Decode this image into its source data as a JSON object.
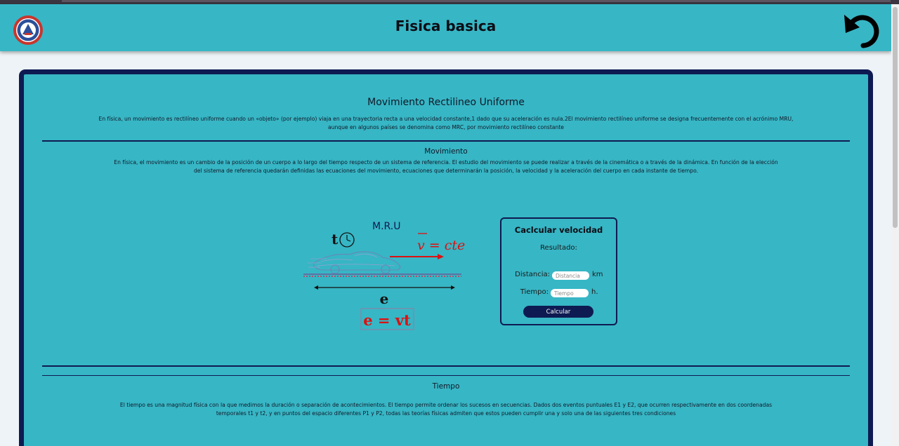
{
  "header": {
    "title": "Fisica basica",
    "logo_icon": "university-seal-logo",
    "back_icon": "undo-arrow-icon",
    "background": "#37b6c5"
  },
  "colors": {
    "card_border": "#0e1a52",
    "card_bg": "#37b6c5",
    "arrow_red": "#dd1111",
    "button": "#0e1a52"
  },
  "intro": {
    "title": "Movimiento Rectilineo Uniforme",
    "text_line1": "En física, un movimiento es rectilíneo uniforme cuando un «objeto» (por ejemplo) viaja en una trayectoria recta a una velocidad constante,1 dado que su aceleración es nula.2El movimiento rectilíneo uniforme se designa frecuentemente con el acrónimo MRU,",
    "text_line2": "aunque en algunos países se denomina como MRC, por movimiento rectilíneo constante"
  },
  "movimiento": {
    "title": "Movimiento",
    "text_line1": "En física, el movimiento es un cambio de la posición de un cuerpo a lo largo del tiempo respecto de un sistema de referencia. El estudio del movimiento se puede realizar a través de la cinemática o a través de la dinámica. En función de la elección",
    "text_line2": "del sistema de referencia quedarán definidas las ecuaciones del movimiento, ecuaciones que determinarán la posición, la velocidad y la aceleración del cuerpo en cada instante de tiempo."
  },
  "figure": {
    "label_mru": "M.R.U",
    "label_t": "t",
    "label_v": "v = cte",
    "label_e": "e",
    "formula": "e = vt",
    "clock_icon": "clock-icon",
    "car_icon": "car-sketch-icon"
  },
  "calculator": {
    "title": "Caclcular velocidad",
    "result_label": "Resultado:",
    "distance_label": "Distancia:",
    "distance_placeholder": "Distancia",
    "distance_unit": "km",
    "time_label": "Tiempo:",
    "time_placeholder": "Tiempo",
    "time_unit": "h.",
    "button_label": "Calcular"
  },
  "tiempo": {
    "title": "Tiempo",
    "text_line1": "El tiempo es una magnitud física con la que medimos la duración o separación de acontecimientos. El tiempo permite ordenar los sucesos en secuencias. Dados dos eventos puntuales E1 y E2, que ocurren respectivamente en dos coordenadas",
    "text_line2": "temporales t1 y t2, y en puntos del espacio diferentes P1 y P2, todas las teorías físicas admiten que estos pueden cumplir una y solo una de las siguientes tres condiciones"
  }
}
